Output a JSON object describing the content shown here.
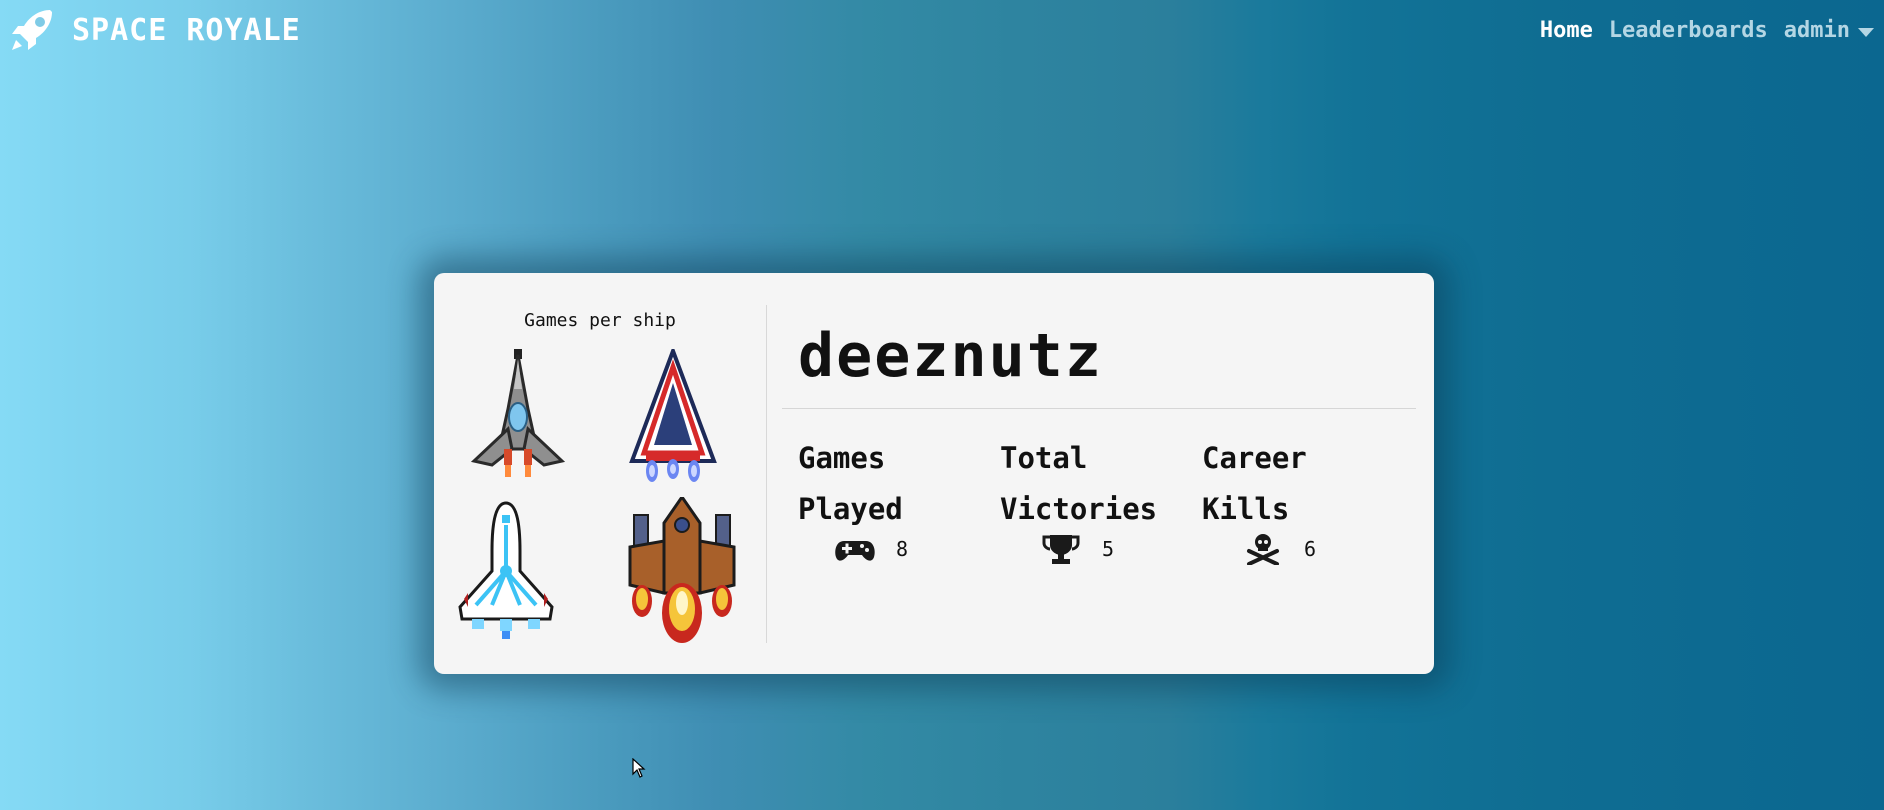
{
  "brand": {
    "title": "SPACE ROYALE",
    "icon": "rocket-icon"
  },
  "nav": {
    "home": "Home",
    "leaderboards": "Leaderboards",
    "user": "admin"
  },
  "card": {
    "ships_title": "Games per ship",
    "username": "deeznutz",
    "stats": [
      {
        "label_line1": "Games",
        "label_line2": "Played",
        "icon": "gamepad-icon",
        "value": "8"
      },
      {
        "label_line1": "Total",
        "label_line2": "Victories",
        "icon": "trophy-icon",
        "value": "5"
      },
      {
        "label_line1": "Career",
        "label_line2": "Kills",
        "icon": "skull-crossbones-icon",
        "value": "6"
      }
    ]
  },
  "colors": {
    "accent_text": "#ffffff",
    "inactive_nav": "#b4d6e4",
    "card_bg": "#f5f5f5"
  }
}
